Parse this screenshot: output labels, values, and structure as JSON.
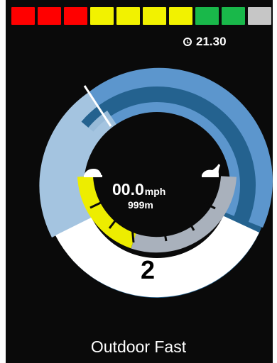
{
  "battery": {
    "segments": [
      {
        "level": "red",
        "color": "#ff0000"
      },
      {
        "level": "red",
        "color": "#ff0000"
      },
      {
        "level": "red",
        "color": "#ff0000"
      },
      {
        "level": "yellow",
        "color": "#f2f200"
      },
      {
        "level": "yellow",
        "color": "#f2f200"
      },
      {
        "level": "yellow",
        "color": "#f2f200"
      },
      {
        "level": "yellow",
        "color": "#f2f200"
      },
      {
        "level": "green",
        "color": "#19b84a"
      },
      {
        "level": "green",
        "color": "#19b84a"
      },
      {
        "level": "inactive",
        "color": "#c6c6c6"
      }
    ]
  },
  "clock": {
    "icon": "clock-icon",
    "value": "21.30"
  },
  "speedometer": {
    "speed_value": "00.0",
    "speed_unit": "mph",
    "distance": "999m",
    "left_icon": "tortoise-icon",
    "right_icon": "hare-icon"
  },
  "profile": {
    "number": "2",
    "name": "Outdoor Fast"
  },
  "colors": {
    "background": "#0a0a0a",
    "ring_dark": "#24628f",
    "ring_mid": "#5c96cd",
    "ring_light": "#a4c4e0",
    "speed_yellow": "#eded00",
    "speed_grey": "#a9b1bc",
    "profile_panel": "#ffffff"
  }
}
